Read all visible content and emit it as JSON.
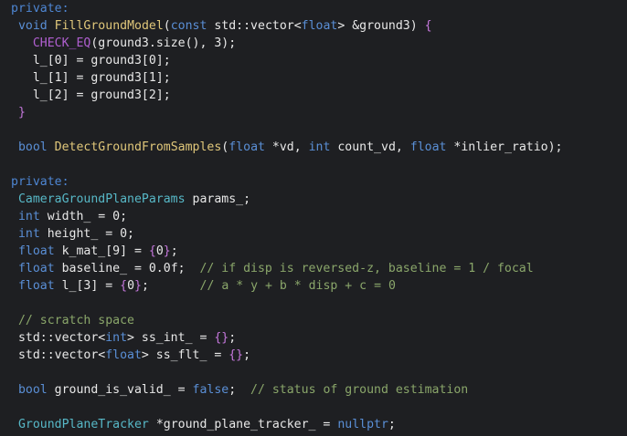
{
  "editor": {
    "lines": [
      {
        "tokens": [
          {
            "t": "private:",
            "c": "acc"
          }
        ]
      },
      {
        "tokens": [
          {
            "t": " ",
            "c": "plain"
          },
          {
            "t": "void",
            "c": "kw"
          },
          {
            "t": " ",
            "c": "plain"
          },
          {
            "t": "FillGroundModel",
            "c": "fn"
          },
          {
            "t": "(",
            "c": "plain"
          },
          {
            "t": "const",
            "c": "kw"
          },
          {
            "t": " std::vector<",
            "c": "plain"
          },
          {
            "t": "float",
            "c": "kw"
          },
          {
            "t": "> &ground3) ",
            "c": "plain"
          },
          {
            "t": "{",
            "c": "brace"
          }
        ]
      },
      {
        "tokens": [
          {
            "t": "   ",
            "c": "plain"
          },
          {
            "t": "CHECK_EQ",
            "c": "macro"
          },
          {
            "t": "(ground3.size(), 3);",
            "c": "plain"
          }
        ]
      },
      {
        "tokens": [
          {
            "t": "   l_[0] = ground3[0];",
            "c": "plain"
          }
        ]
      },
      {
        "tokens": [
          {
            "t": "   l_[1] = ground3[1];",
            "c": "plain"
          }
        ]
      },
      {
        "tokens": [
          {
            "t": "   l_[2] = ground3[2];",
            "c": "plain"
          }
        ]
      },
      {
        "tokens": [
          {
            "t": " ",
            "c": "plain"
          },
          {
            "t": "}",
            "c": "brace"
          }
        ]
      },
      {
        "tokens": [
          {
            "t": "",
            "c": "plain"
          }
        ]
      },
      {
        "tokens": [
          {
            "t": " ",
            "c": "plain"
          },
          {
            "t": "bool",
            "c": "kw"
          },
          {
            "t": " ",
            "c": "plain"
          },
          {
            "t": "DetectGroundFromSamples",
            "c": "fn"
          },
          {
            "t": "(",
            "c": "plain"
          },
          {
            "t": "float",
            "c": "kw"
          },
          {
            "t": " *vd, ",
            "c": "plain"
          },
          {
            "t": "int",
            "c": "kw"
          },
          {
            "t": " count_vd, ",
            "c": "plain"
          },
          {
            "t": "float",
            "c": "kw"
          },
          {
            "t": " *inlier_ratio);",
            "c": "plain"
          }
        ]
      },
      {
        "tokens": [
          {
            "t": "",
            "c": "plain"
          }
        ]
      },
      {
        "tokens": [
          {
            "t": "private:",
            "c": "acc"
          }
        ]
      },
      {
        "tokens": [
          {
            "t": " ",
            "c": "plain"
          },
          {
            "t": "CameraGroundPlaneParams",
            "c": "type"
          },
          {
            "t": " params_;",
            "c": "plain"
          }
        ]
      },
      {
        "tokens": [
          {
            "t": " ",
            "c": "plain"
          },
          {
            "t": "int",
            "c": "kw"
          },
          {
            "t": " width_ = 0;",
            "c": "plain"
          }
        ]
      },
      {
        "tokens": [
          {
            "t": " ",
            "c": "plain"
          },
          {
            "t": "int",
            "c": "kw"
          },
          {
            "t": " height_ = 0;",
            "c": "plain"
          }
        ]
      },
      {
        "tokens": [
          {
            "t": " ",
            "c": "plain"
          },
          {
            "t": "float",
            "c": "kw"
          },
          {
            "t": " k_mat_[9] = ",
            "c": "plain"
          },
          {
            "t": "{",
            "c": "brace"
          },
          {
            "t": "0",
            "c": "plain"
          },
          {
            "t": "}",
            "c": "brace"
          },
          {
            "t": ";",
            "c": "plain"
          }
        ]
      },
      {
        "tokens": [
          {
            "t": " ",
            "c": "plain"
          },
          {
            "t": "float",
            "c": "kw"
          },
          {
            "t": " baseline_ = 0.0f;  ",
            "c": "plain"
          },
          {
            "t": "// if disp is reversed-z, baseline = 1 / focal",
            "c": "cmt"
          }
        ]
      },
      {
        "tokens": [
          {
            "t": " ",
            "c": "plain"
          },
          {
            "t": "float",
            "c": "kw"
          },
          {
            "t": " l_[3] = ",
            "c": "plain"
          },
          {
            "t": "{",
            "c": "brace"
          },
          {
            "t": "0",
            "c": "plain"
          },
          {
            "t": "}",
            "c": "brace"
          },
          {
            "t": ";       ",
            "c": "plain"
          },
          {
            "t": "// a * y + b * disp + c = 0",
            "c": "cmt"
          }
        ]
      },
      {
        "tokens": [
          {
            "t": "",
            "c": "plain"
          }
        ]
      },
      {
        "tokens": [
          {
            "t": " ",
            "c": "plain"
          },
          {
            "t": "// scratch space",
            "c": "cmt"
          }
        ]
      },
      {
        "tokens": [
          {
            "t": " std::vector<",
            "c": "plain"
          },
          {
            "t": "int",
            "c": "kw"
          },
          {
            "t": "> ss_int_ = ",
            "c": "plain"
          },
          {
            "t": "{}",
            "c": "brace"
          },
          {
            "t": ";",
            "c": "plain"
          }
        ]
      },
      {
        "tokens": [
          {
            "t": " std::vector<",
            "c": "plain"
          },
          {
            "t": "float",
            "c": "kw"
          },
          {
            "t": "> ss_flt_ = ",
            "c": "plain"
          },
          {
            "t": "{}",
            "c": "brace"
          },
          {
            "t": ";",
            "c": "plain"
          }
        ]
      },
      {
        "tokens": [
          {
            "t": "",
            "c": "plain"
          }
        ]
      },
      {
        "tokens": [
          {
            "t": " ",
            "c": "plain"
          },
          {
            "t": "bool",
            "c": "kw"
          },
          {
            "t": " ground_is_valid_ = ",
            "c": "plain"
          },
          {
            "t": "false",
            "c": "kw"
          },
          {
            "t": ";  ",
            "c": "plain"
          },
          {
            "t": "// status of ground estimation",
            "c": "cmt"
          }
        ]
      },
      {
        "tokens": [
          {
            "t": "",
            "c": "plain"
          }
        ]
      },
      {
        "tokens": [
          {
            "t": " ",
            "c": "plain"
          },
          {
            "t": "GroundPlaneTracker",
            "c": "type"
          },
          {
            "t": " *ground_plane_tracker_ = ",
            "c": "plain"
          },
          {
            "t": "nullptr",
            "c": "kw"
          },
          {
            "t": ";",
            "c": "plain"
          }
        ]
      }
    ]
  },
  "colors": {
    "background": "#1e1f22",
    "keyword": "#5a8fd6",
    "function": "#e0c77a",
    "type": "#57b8c7",
    "brace": "#c678dd",
    "comment": "#8aa66a",
    "text": "#e8e8e8"
  }
}
